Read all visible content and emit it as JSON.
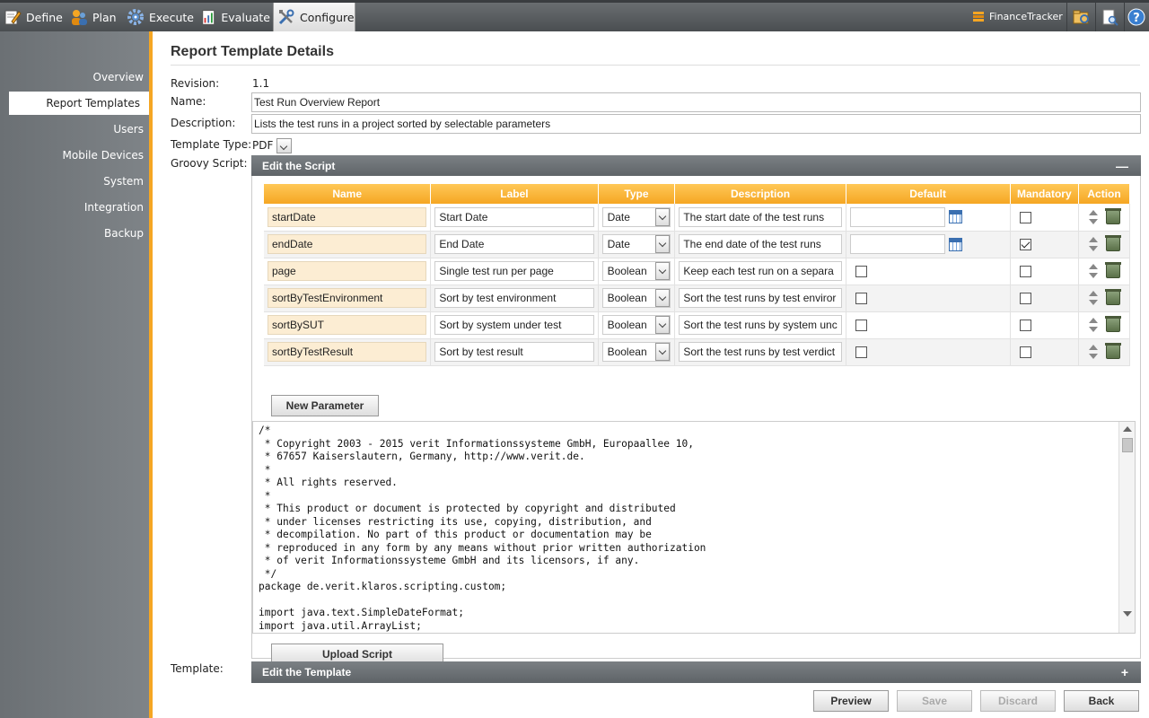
{
  "nav": {
    "items": [
      {
        "label": "Define",
        "icon": "pencil-icon"
      },
      {
        "label": "Plan",
        "icon": "people-icon"
      },
      {
        "label": "Execute",
        "icon": "gear-icon"
      },
      {
        "label": "Evaluate",
        "icon": "report-icon"
      },
      {
        "label": "Configure",
        "icon": "tools-icon"
      }
    ],
    "project": "FinanceTracker"
  },
  "sidebar": {
    "items": [
      "Overview",
      "Report Templates",
      "Users",
      "Mobile Devices",
      "System",
      "Integration",
      "Backup"
    ],
    "active": "Report Templates"
  },
  "page": {
    "title": "Report Template Details",
    "revision_label": "Revision:",
    "revision": "1.1",
    "name_label": "Name:",
    "name": "Test Run Overview Report",
    "description_label": "Description:",
    "description": "Lists the test runs in a project sorted by selectable parameters",
    "template_type_label": "Template Type:",
    "template_type": "PDF",
    "groovy_label": "Groovy Script:",
    "script_panel_title": "Edit the Script",
    "template_label": "Template:",
    "template_panel_title": "Edit the Template"
  },
  "params": {
    "headers": [
      "Name",
      "Label",
      "Type",
      "Description",
      "Default",
      "Mandatory",
      "Action"
    ],
    "rows": [
      {
        "name": "startDate",
        "label": "Start Date",
        "type": "Date",
        "description": "The start date of the test runs",
        "mandatory": false
      },
      {
        "name": "endDate",
        "label": "End Date",
        "type": "Date",
        "description": "The end date of the test runs",
        "mandatory": true
      },
      {
        "name": "page",
        "label": "Single test run per page",
        "type": "Boolean",
        "description": "Keep each test run on a separa",
        "mandatory": false
      },
      {
        "name": "sortByTestEnvironment",
        "label": "Sort by test environment",
        "type": "Boolean",
        "description": "Sort the test runs by test enviror",
        "mandatory": false
      },
      {
        "name": "sortBySUT",
        "label": "Sort by system under test",
        "type": "Boolean",
        "description": "Sort the test runs by system unc",
        "mandatory": false
      },
      {
        "name": "sortByTestResult",
        "label": "Sort by test result",
        "type": "Boolean",
        "description": "Sort the test runs by test verdict",
        "mandatory": false
      }
    ]
  },
  "buttons": {
    "new_parameter": "New Parameter",
    "upload_script": "Upload Script",
    "preview": "Preview",
    "save": "Save",
    "discard": "Discard",
    "back": "Back"
  },
  "script": "/*\n * Copyright 2003 - 2015 verit Informationssysteme GmbH, Europaallee 10,\n * 67657 Kaiserslautern, Germany, http://www.verit.de.\n *\n * All rights reserved.\n *\n * This product or document is protected by copyright and distributed\n * under licenses restricting its use, copying, distribution, and\n * decompilation. No part of this product or documentation may be\n * reproduced in any form by any means without prior written authorization\n * of verit Informationssysteme GmbH and its licensors, if any.\n */\npackage de.verit.klaros.scripting.custom;\n\nimport java.text.SimpleDateFormat;\nimport java.util.ArrayList;"
}
